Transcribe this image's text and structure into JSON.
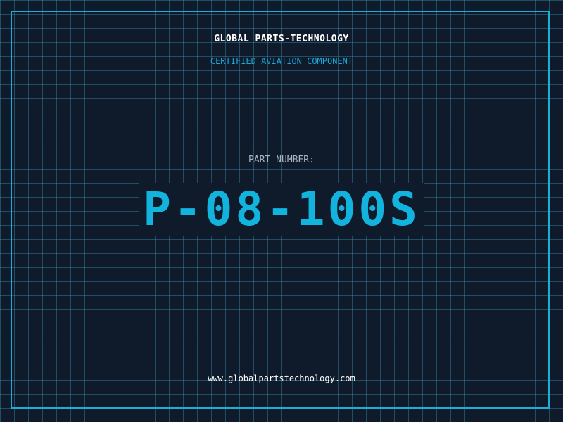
{
  "header": {
    "company": "GLOBAL PARTS-TECHNOLOGY",
    "subtitle": "CERTIFIED AVIATION COMPONENT"
  },
  "part": {
    "label": "PART NUMBER:",
    "number": "P-08-100S"
  },
  "footer": {
    "url": "www.globalpartstechnology.com"
  },
  "colors": {
    "background": "#0f1a2b",
    "grid": "#388caa",
    "accent": "#12b4de",
    "frame": "#1ab0d6",
    "text_primary": "#ffffff",
    "text_muted": "#a9b4c2"
  }
}
